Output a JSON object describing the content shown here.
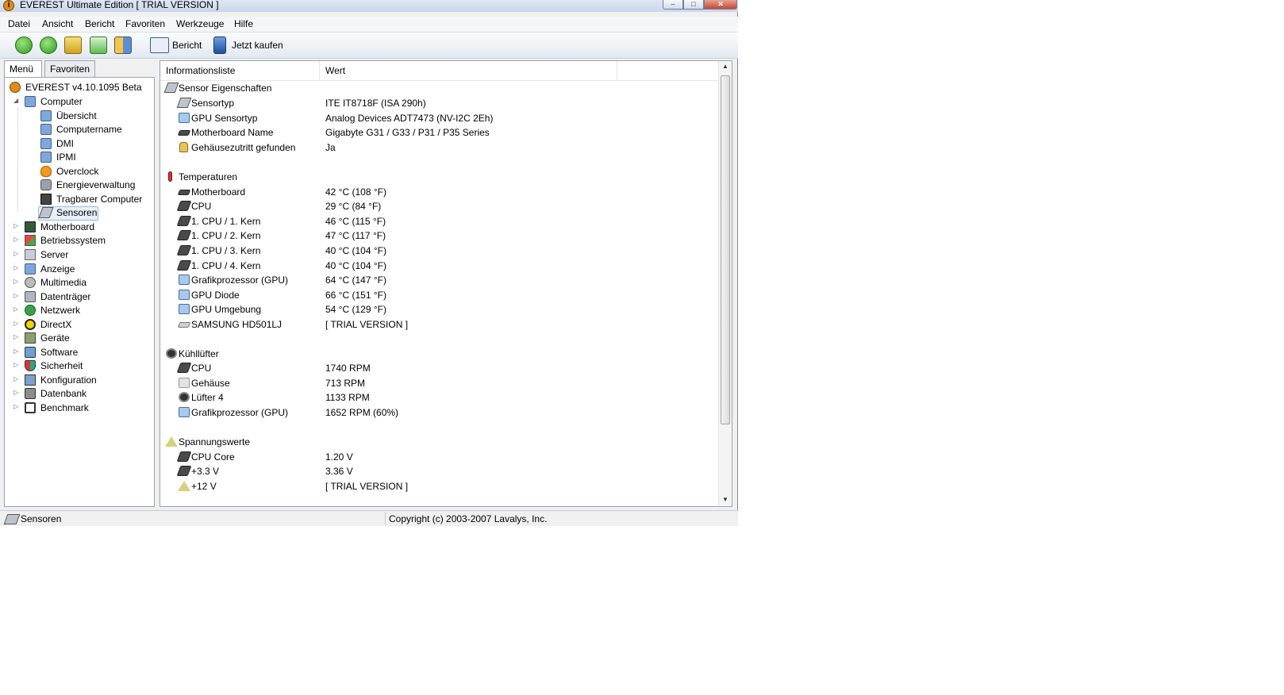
{
  "window": {
    "title": "EVEREST Ultimate Edition  [ TRIAL VERSION ]",
    "controls": {
      "min": "–",
      "max": "□",
      "close": "✕"
    }
  },
  "menubar": [
    "Datei",
    "Ansicht",
    "Bericht",
    "Favoriten",
    "Werkzeuge",
    "Hilfe"
  ],
  "toolbar": {
    "report_label": "Bericht",
    "buy_label": "Jetzt kaufen"
  },
  "tabs": {
    "menu": "Menü",
    "favorites": "Favoriten"
  },
  "tree": {
    "root": "EVEREST v4.10.1095 Beta",
    "computer": "Computer",
    "computer_children": [
      "Übersicht",
      "Computername",
      "DMI",
      "IPMI",
      "Overclock",
      "Energieverwaltung",
      "Tragbarer Computer",
      "Sensoren"
    ],
    "top_items": [
      "Motherboard",
      "Betriebssystem",
      "Server",
      "Anzeige",
      "Multimedia",
      "Datenträger",
      "Netzwerk",
      "DirectX",
      "Geräte",
      "Software",
      "Sicherheit",
      "Konfiguration",
      "Datenbank",
      "Benchmark"
    ],
    "selected": "Sensoren"
  },
  "list": {
    "col_name": "Informationsliste",
    "col_value": "Wert",
    "sections": [
      {
        "title": "Sensor Eigenschaften",
        "icon": "sensor-icon",
        "rows": [
          {
            "name": "Sensortyp",
            "value": "ITE IT8718F  (ISA 290h)",
            "icon": "sensor-icon"
          },
          {
            "name": "GPU Sensortyp",
            "value": "Analog Devices ADT7473  (NV-I2C 2Eh)",
            "icon": "monitor-icon"
          },
          {
            "name": "Motherboard Name",
            "value": "Gigabyte G31 / G33 / P31 / P35 Series",
            "icon": "motherboard-icon"
          },
          {
            "name": "Gehäusezutritt gefunden",
            "value": "Ja",
            "icon": "lock-icon"
          }
        ]
      },
      {
        "title": "Temperaturen",
        "icon": "thermometer-icon",
        "rows": [
          {
            "name": "Motherboard",
            "value": "42 °C  (108 °F)",
            "icon": "motherboard-icon"
          },
          {
            "name": "CPU",
            "value": "29 °C  (84 °F)",
            "icon": "chip-icon"
          },
          {
            "name": "1. CPU / 1. Kern",
            "value": "46 °C  (115 °F)",
            "icon": "chip-icon"
          },
          {
            "name": "1. CPU / 2. Kern",
            "value": "47 °C  (117 °F)",
            "icon": "chip-icon"
          },
          {
            "name": "1. CPU / 3. Kern",
            "value": "40 °C  (104 °F)",
            "icon": "chip-icon"
          },
          {
            "name": "1. CPU / 4. Kern",
            "value": "40 °C  (104 °F)",
            "icon": "chip-icon"
          },
          {
            "name": "Grafikprozessor (GPU)",
            "value": "64 °C  (147 °F)",
            "icon": "monitor-icon"
          },
          {
            "name": "GPU Diode",
            "value": "66 °C  (151 °F)",
            "icon": "monitor-icon"
          },
          {
            "name": "GPU Umgebung",
            "value": "54 °C  (129 °F)",
            "icon": "monitor-icon"
          },
          {
            "name": "SAMSUNG HD501LJ",
            "value": "[ TRIAL VERSION ]",
            "icon": "hdd-icon"
          }
        ]
      },
      {
        "title": "Kühllüfter",
        "icon": "fan-icon",
        "rows": [
          {
            "name": "CPU",
            "value": "1740 RPM",
            "icon": "chip-icon"
          },
          {
            "name": "Gehäuse",
            "value": "713 RPM",
            "icon": "case-icon"
          },
          {
            "name": "Lüfter 4",
            "value": "1133 RPM",
            "icon": "fan-icon"
          },
          {
            "name": "Grafikprozessor (GPU)",
            "value": "1652 RPM  (60%)",
            "icon": "monitor-icon"
          }
        ]
      },
      {
        "title": "Spannungswerte",
        "icon": "voltage-icon",
        "rows": [
          {
            "name": "CPU Core",
            "value": "1.20 V",
            "icon": "chip-icon"
          },
          {
            "name": "+3.3 V",
            "value": "3.36 V",
            "icon": "chip-icon"
          },
          {
            "name": "+12 V",
            "value": "[ TRIAL VERSION ]",
            "icon": "voltage-icon"
          }
        ]
      }
    ]
  },
  "statusbar": {
    "left": "Sensoren",
    "right": "Copyright (c) 2003-2007 Lavalys, Inc."
  }
}
